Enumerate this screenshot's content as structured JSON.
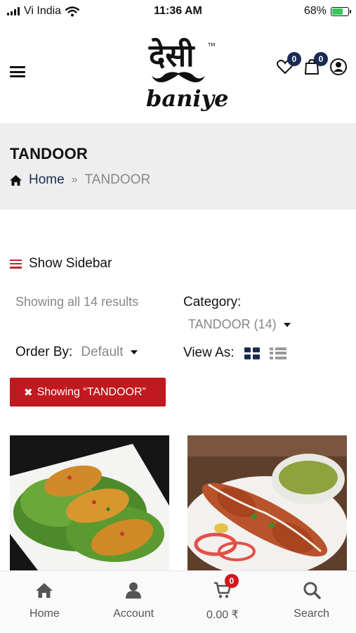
{
  "status_bar": {
    "carrier": "Vi India",
    "time": "11:36 AM",
    "battery_percent": "68%",
    "battery_level": 0.68
  },
  "header": {
    "logo_text_top": "देसी",
    "logo_text_bottom": "baniye",
    "logo_tm": "TM",
    "wishlist_count": "0",
    "bag_count": "0"
  },
  "page": {
    "title": "TANDOOR",
    "breadcrumb_home": "Home",
    "breadcrumb_sep": "»",
    "breadcrumb_current": "TANDOOR"
  },
  "filters": {
    "show_sidebar": "Show Sidebar",
    "results_text": "Showing all 14 results",
    "category_label": "Category:",
    "category_value": "TANDOOR (14)",
    "order_label": "Order By:",
    "order_value": "Default",
    "view_label": "View As:",
    "active_filter": "Showing “TANDOOR”"
  },
  "bottom_nav": {
    "home": "Home",
    "account": "Account",
    "cart": "0.00 ₹",
    "cart_count": "0",
    "search": "Search"
  },
  "colors": {
    "brand_navy": "#1b2a52",
    "accent_red": "#c0191f"
  },
  "icons": [
    "signal-icon",
    "wifi-icon",
    "battery-icon",
    "menu-icon",
    "heart-icon",
    "bag-icon",
    "user-icon",
    "home-icon",
    "grid-view-icon",
    "list-view-icon",
    "close-icon",
    "cart-icon",
    "search-icon"
  ]
}
